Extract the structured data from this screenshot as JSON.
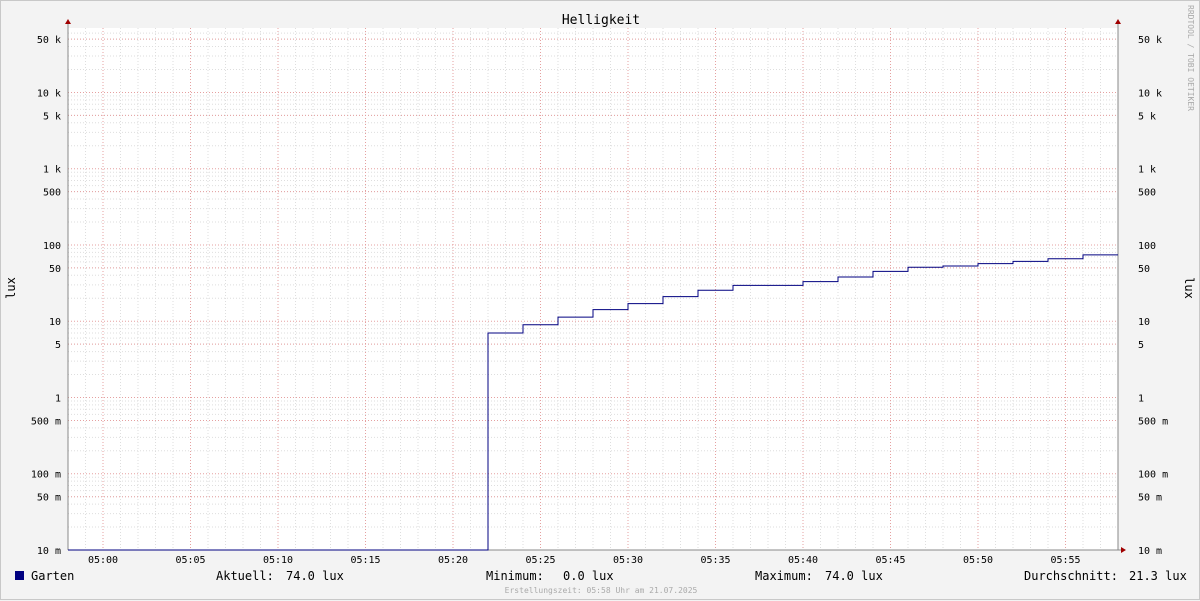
{
  "chart_data": {
    "type": "line",
    "title": "Helligkeit",
    "ylabel": "lux",
    "watermark": "RRDTOOL / TOBI OETIKER",
    "footer": "Erstellungszeit: 05:58 Uhr am 21.07.2025",
    "y_scale": "log",
    "ylim": [
      0.01,
      70000
    ],
    "xlim": [
      "04:58",
      "05:58"
    ],
    "x_ticks": [
      "05:00",
      "05:05",
      "05:10",
      "05:15",
      "05:20",
      "05:25",
      "05:30",
      "05:35",
      "05:40",
      "05:45",
      "05:50",
      "05:55"
    ],
    "y_ticks": [
      {
        "value": 50000,
        "label": "50 k"
      },
      {
        "value": 10000,
        "label": "10 k"
      },
      {
        "value": 5000,
        "label": "5 k"
      },
      {
        "value": 1000,
        "label": "1 k"
      },
      {
        "value": 500,
        "label": "500"
      },
      {
        "value": 100,
        "label": "100"
      },
      {
        "value": 50,
        "label": "50"
      },
      {
        "value": 10,
        "label": "10"
      },
      {
        "value": 5,
        "label": "5"
      },
      {
        "value": 1,
        "label": "1"
      },
      {
        "value": 0.5,
        "label": "500 m"
      },
      {
        "value": 0.1,
        "label": "100 m"
      },
      {
        "value": 0.05,
        "label": "50 m"
      },
      {
        "value": 0.01,
        "label": "10 m"
      }
    ],
    "grid": true,
    "series": [
      {
        "name": "Garten",
        "color": "#000080",
        "points": [
          {
            "x": "04:58",
            "y": 0.0
          },
          {
            "x": "05:22",
            "y": 7.0
          },
          {
            "x": "05:24",
            "y": 9.0
          },
          {
            "x": "05:26",
            "y": 11.3
          },
          {
            "x": "05:28",
            "y": 14.2
          },
          {
            "x": "05:30",
            "y": 17.0
          },
          {
            "x": "05:32",
            "y": 21.0
          },
          {
            "x": "05:34",
            "y": 25.5
          },
          {
            "x": "05:36",
            "y": 29.5
          },
          {
            "x": "05:40",
            "y": 33.0
          },
          {
            "x": "05:42",
            "y": 38.0
          },
          {
            "x": "05:44",
            "y": 45.0
          },
          {
            "x": "05:46",
            "y": 51.0
          },
          {
            "x": "05:48",
            "y": 53.0
          },
          {
            "x": "05:50",
            "y": 57.0
          },
          {
            "x": "05:52",
            "y": 61.0
          },
          {
            "x": "05:54",
            "y": 66.0
          },
          {
            "x": "05:56",
            "y": 74.0
          },
          {
            "x": "05:58",
            "y": 74.0
          }
        ]
      }
    ],
    "legend": {
      "placement": "bottom",
      "name": "Garten",
      "stats": [
        {
          "label": "Aktuell:",
          "value": "74.0 lux"
        },
        {
          "label": "Minimum:",
          "value": "0.0 lux"
        },
        {
          "label": "Maximum:",
          "value": "74.0 lux"
        },
        {
          "label": "Durchschnitt:",
          "value": "21.3 lux"
        }
      ]
    }
  }
}
